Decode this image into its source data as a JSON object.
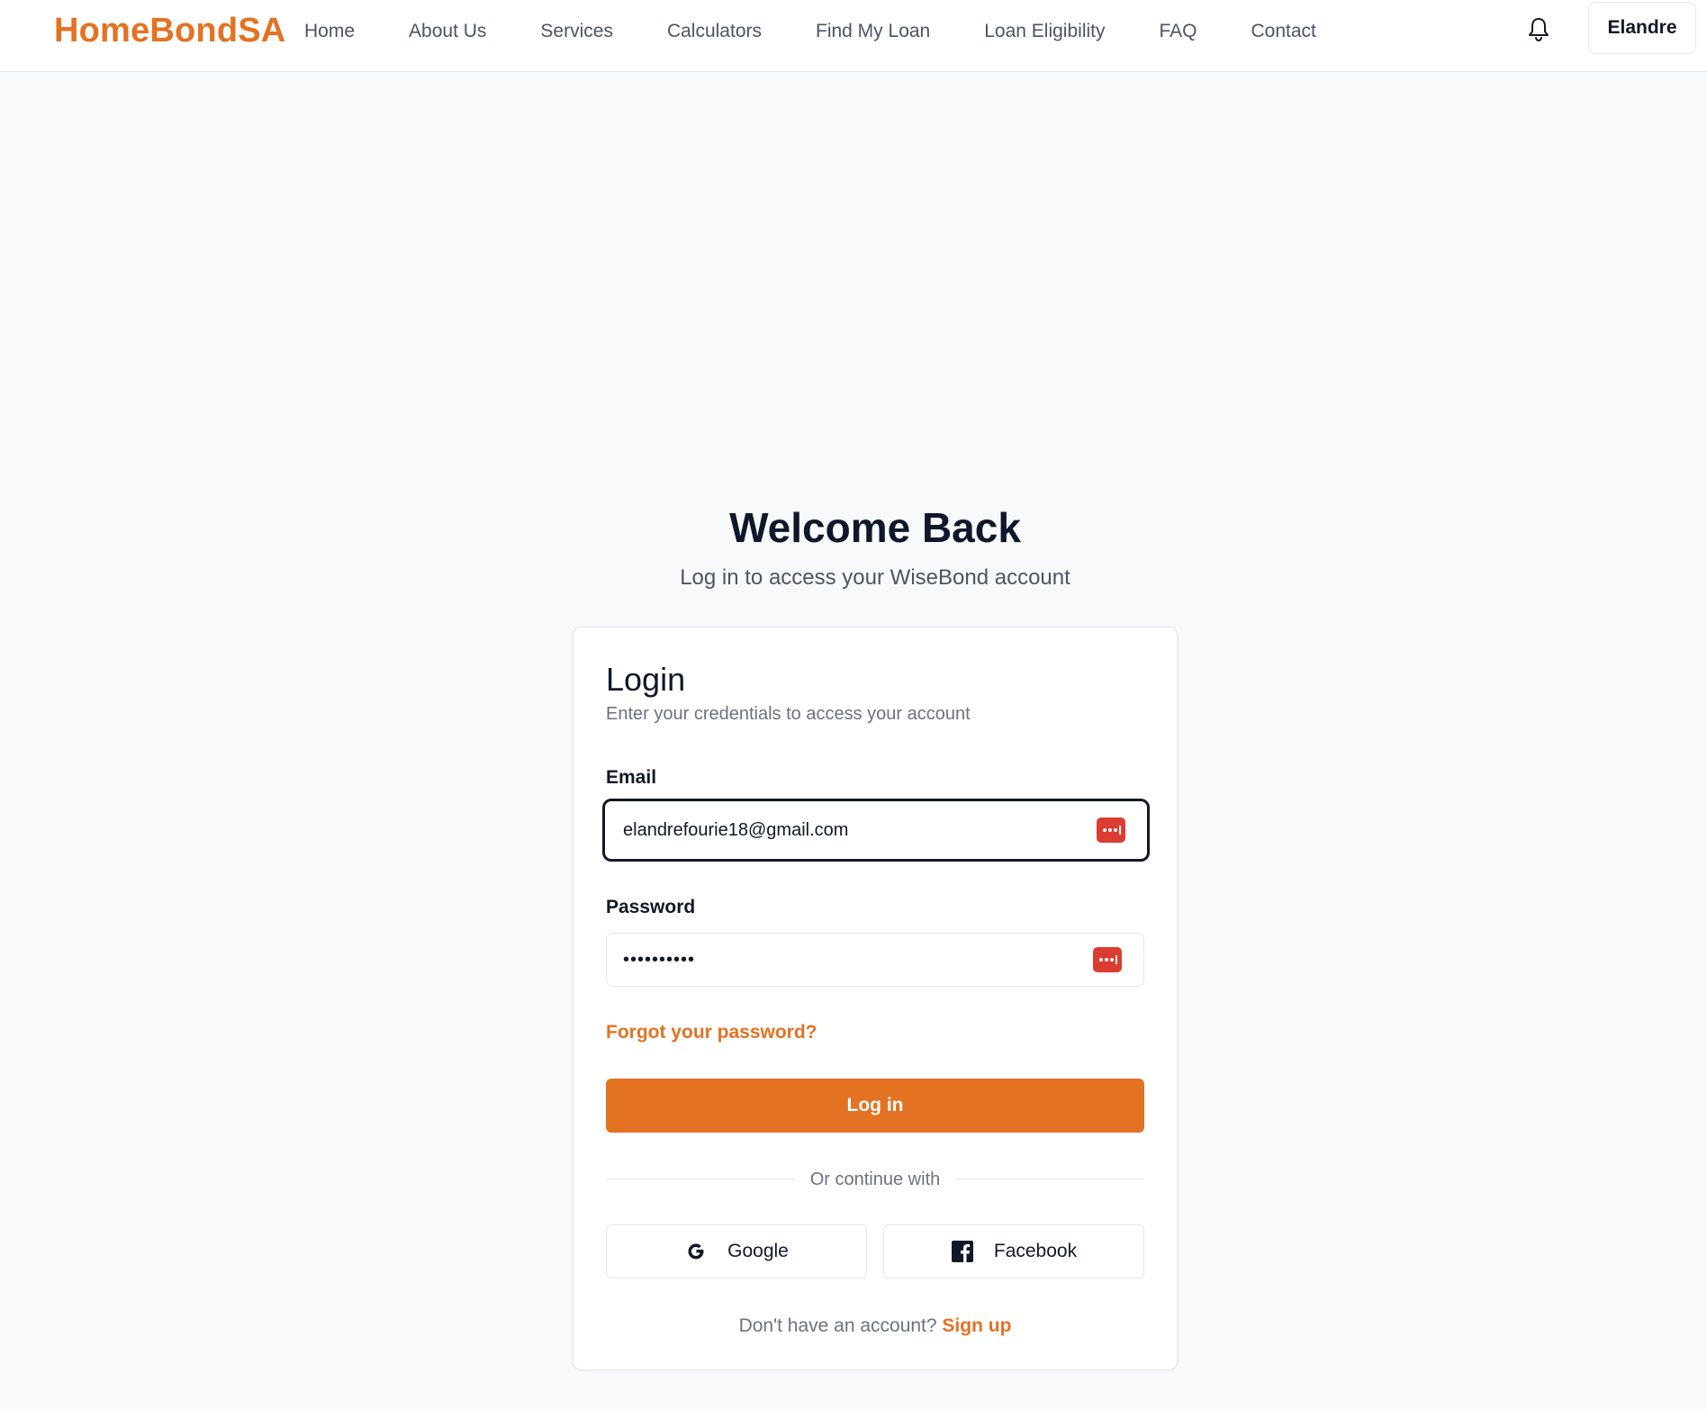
{
  "nav": {
    "brand": "HomeBondSA",
    "links": [
      "Home",
      "About Us",
      "Services",
      "Calculators",
      "Find My Loan",
      "Loan Eligibility",
      "FAQ",
      "Contact"
    ],
    "bell_icon": "bell-icon",
    "user_label": "Elandre"
  },
  "hero": {
    "title": "Welcome Back",
    "subtitle": "Log in to access your WiseBond account"
  },
  "login_card": {
    "title": "Login",
    "description": "Enter your credentials to access your account",
    "email_label": "Email",
    "email_value": "elandrefourie18@gmail.com",
    "password_label": "Password",
    "password_value": "••••••••••",
    "password_manager_icon": "password-manager-icon",
    "forgot_password": "Forgot your password?",
    "login_button": "Log in",
    "divider_text": "Or continue with",
    "google_label": "Google",
    "facebook_label": "Facebook",
    "signup_prompt": "Don't have an account?",
    "signup_link": "Sign up"
  },
  "colors": {
    "accent": "#e37222",
    "page_background": "#f8f9fa",
    "password_manager_icon": "#dc3d33",
    "focus_border": "#111827"
  }
}
